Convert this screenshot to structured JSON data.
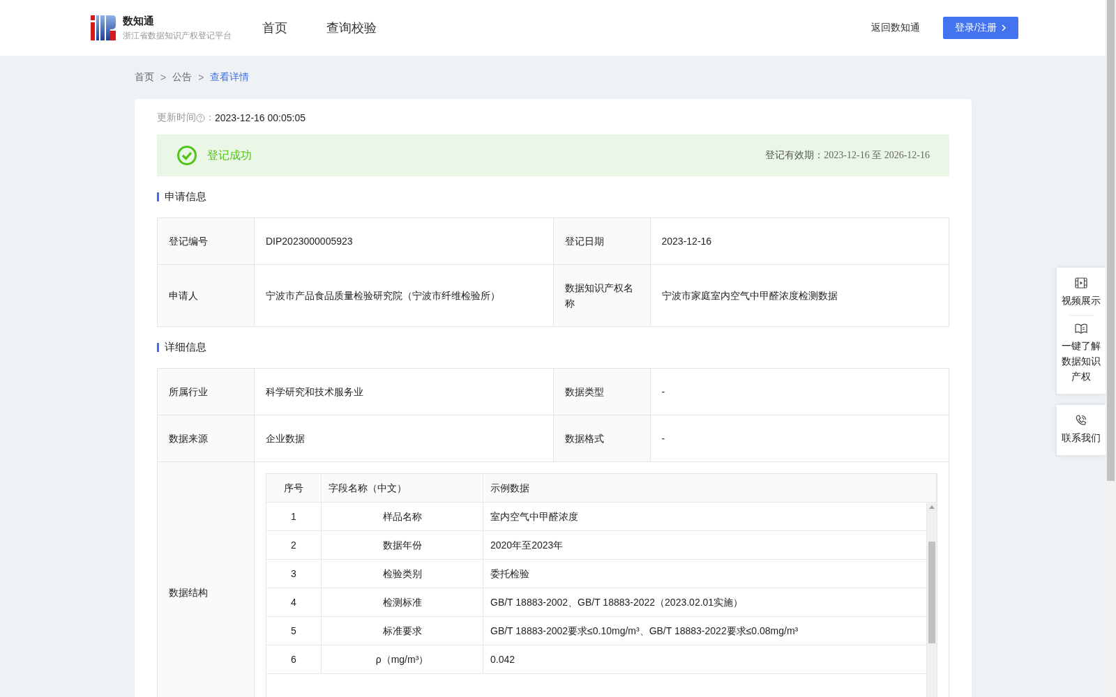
{
  "header": {
    "logo_title": "数知通",
    "logo_subtitle": "浙江省数据知识产权登记平台",
    "nav": [
      {
        "label": "首页"
      },
      {
        "label": "查询校验"
      }
    ],
    "back_link": "返回数知通",
    "login_button": "登录/注册"
  },
  "breadcrumb": [
    {
      "kind": "link",
      "label": "首页"
    },
    {
      "kind": "separator",
      "label": ">"
    },
    {
      "kind": "link",
      "label": "公告"
    },
    {
      "kind": "separator",
      "label": ">"
    },
    {
      "kind": "current",
      "label": "查看详情"
    }
  ],
  "update_time": {
    "label": "更新时间",
    "separator": "：",
    "value": "2023-12-16 00:05:05"
  },
  "status": {
    "text": "登记成功",
    "validity_label": "登记有效期：",
    "validity_value": "2023-12-16 至 2026-12-16"
  },
  "sections": [
    {
      "title": "申请信息",
      "rows": [
        [
          {
            "label": "登记编号",
            "value": "DIP2023000005923"
          },
          {
            "label": "登记日期",
            "value": "2023-12-16"
          }
        ],
        [
          {
            "label": "申请人",
            "value": "宁波市产品食品质量检验研究院（宁波市纤维检验所）"
          },
          {
            "label": "数据知识产权名称",
            "value": "宁波市家庭室内空气中甲醛浓度检测数据"
          }
        ]
      ]
    },
    {
      "title": "详细信息",
      "rows": [
        [
          {
            "label": "所属行业",
            "value": "科学研究和技术服务业"
          },
          {
            "label": "数据类型",
            "value": "-"
          }
        ],
        [
          {
            "label": "数据来源",
            "value": "企业数据"
          },
          {
            "label": "数据格式",
            "value": "-"
          }
        ]
      ],
      "structure": {
        "label": "数据结构",
        "columns": [
          "序号",
          "字段名称（中文）",
          "示例数据"
        ],
        "rows": [
          [
            "1",
            "样品名称",
            "室内空气中甲醛浓度"
          ],
          [
            "2",
            "数据年份",
            "2020年至2023年"
          ],
          [
            "3",
            "检验类别",
            "委托检验"
          ],
          [
            "4",
            "检测标准",
            "GB/T 18883-2002、GB/T 18883-2022（2023.02.01实施）"
          ],
          [
            "5",
            "标准要求",
            "GB/T 18883-2002要求≤0.10mg/m³、GB/T 18883-2022要求≤0.08mg/m³"
          ],
          [
            "6",
            "ρ（mg/m³）",
            "0.042"
          ]
        ]
      }
    }
  ],
  "side_panel": [
    {
      "kind": "video",
      "label": "视频展示"
    },
    {
      "kind": "book",
      "label": "一键了解数据知识产权"
    },
    {
      "kind": "phone",
      "label": "联系我们"
    }
  ]
}
